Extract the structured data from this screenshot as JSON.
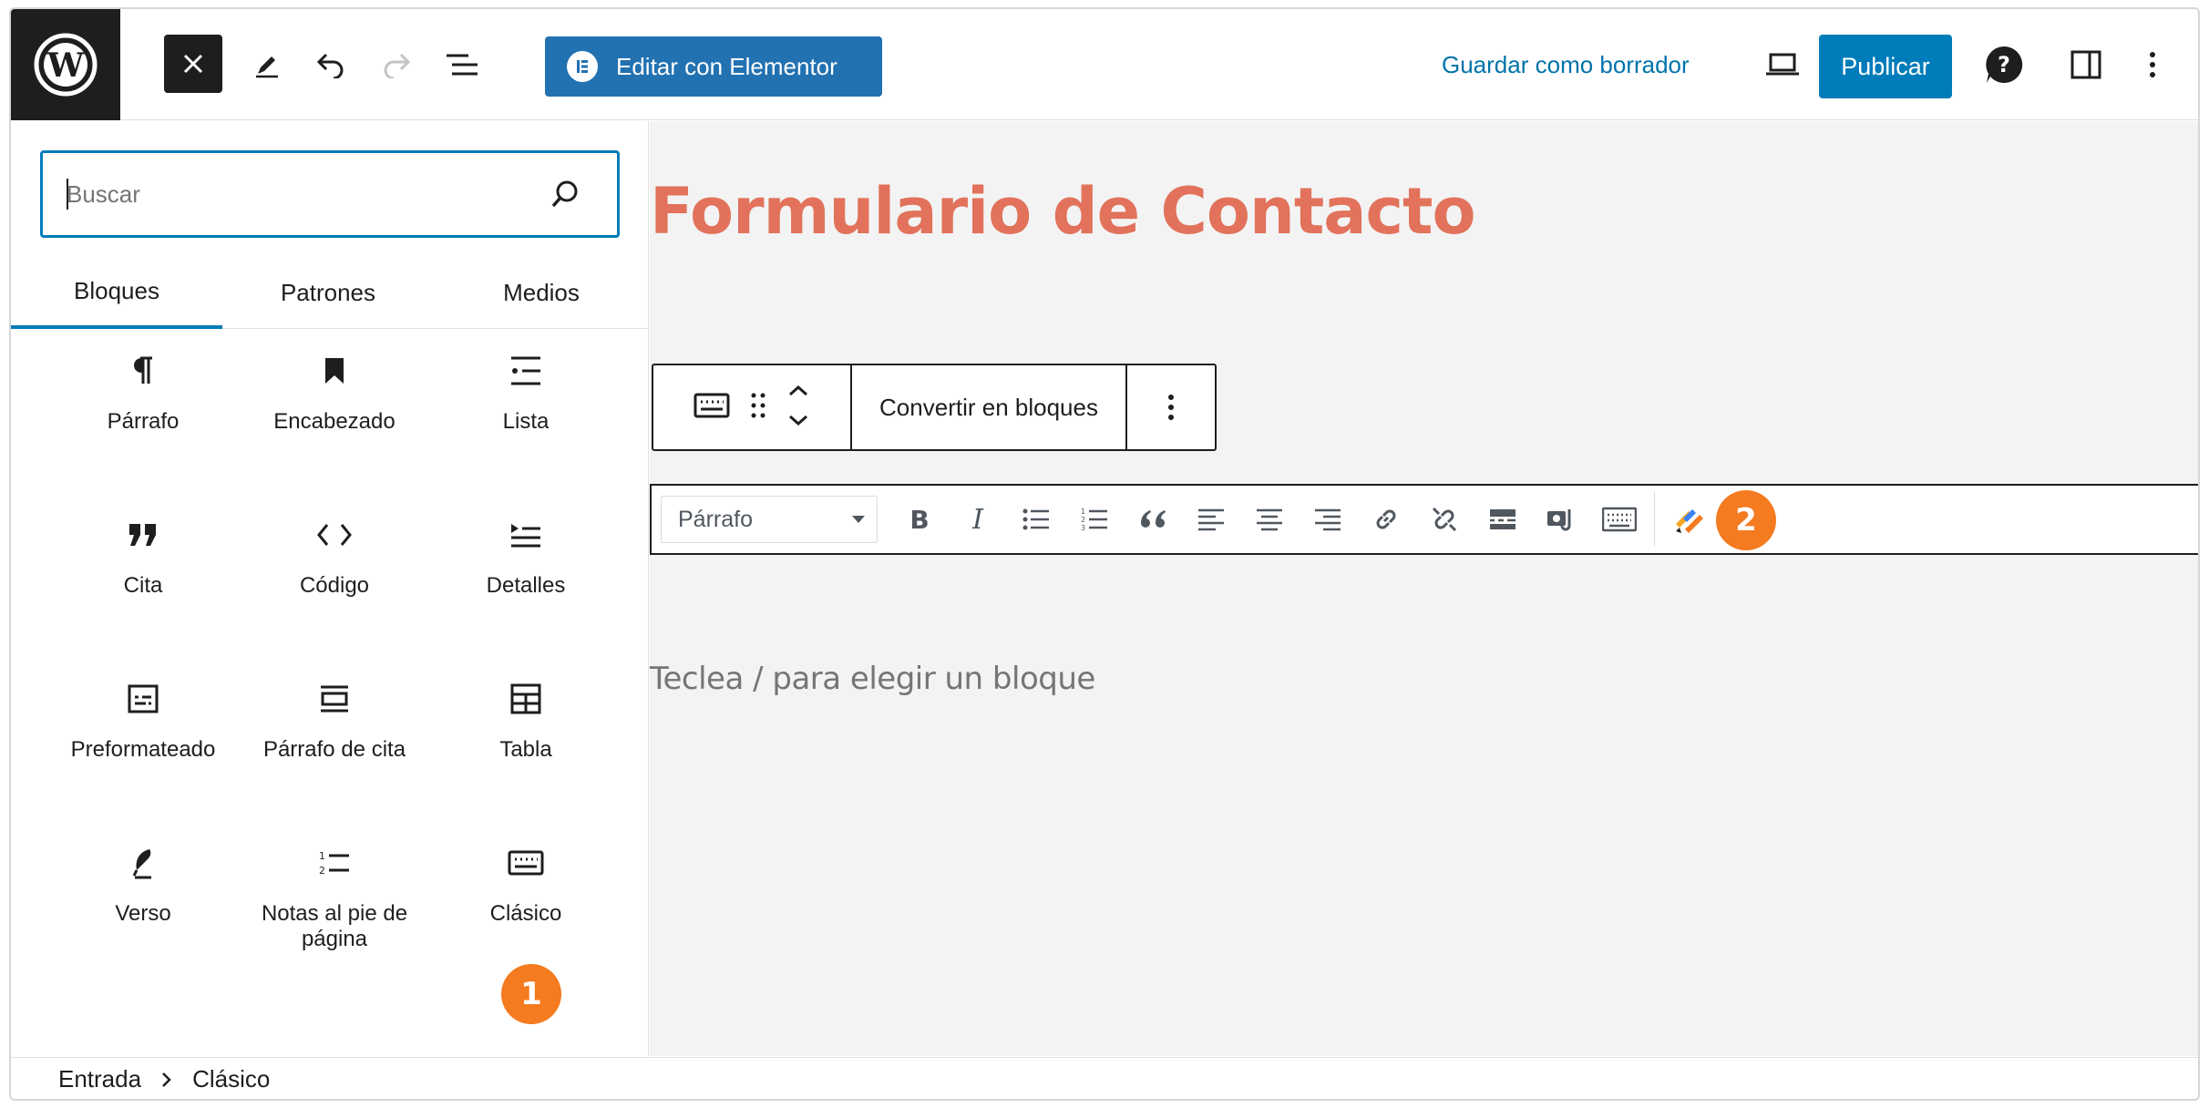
{
  "header": {
    "close_icon": "close-icon",
    "tools_icon": "pencil-icon",
    "undo_icon": "undo-icon",
    "redo_icon": "redo-icon",
    "list_icon": "list-view-icon",
    "elementor_label": "Editar con Elementor",
    "draft_label": "Guardar como borrador",
    "preview_icon": "laptop-icon",
    "publish_label": "Publicar",
    "help_icon": "help-icon",
    "settings_icon": "sidebar-icon",
    "more_icon": "more-vertical-icon",
    "accent_color": "#007cba"
  },
  "inserter": {
    "search": {
      "placeholder": "Buscar",
      "value": ""
    },
    "tabs": [
      {
        "label": "Bloques",
        "active": true
      },
      {
        "label": "Patrones",
        "active": false
      },
      {
        "label": "Medios",
        "active": false
      }
    ],
    "blocks": [
      {
        "label": "Párrafo",
        "icon": "paragraph-icon"
      },
      {
        "label": "Encabezado",
        "icon": "bookmark-icon"
      },
      {
        "label": "Lista",
        "icon": "list-icon"
      },
      {
        "label": "Cita",
        "icon": "quote-icon"
      },
      {
        "label": "Código",
        "icon": "code-icon"
      },
      {
        "label": "Detalles",
        "icon": "details-icon"
      },
      {
        "label": "Preformateado",
        "icon": "preformatted-icon"
      },
      {
        "label": "Párrafo de cita",
        "icon": "pullquote-icon"
      },
      {
        "label": "Tabla",
        "icon": "table-icon"
      },
      {
        "label": "Verso",
        "icon": "feather-icon"
      },
      {
        "label": "Notas al pie de página",
        "icon": "footnotes-icon"
      },
      {
        "label": "Clásico",
        "icon": "keyboard-icon"
      }
    ],
    "marker_1": "1"
  },
  "canvas": {
    "title": "Formulario de Contacto",
    "title_color": "#e2725b",
    "block_toolbar": {
      "convert_label": "Convertir en bloques"
    },
    "classic_toolbar": {
      "format_value": "Párrafo",
      "marker_2": "2"
    },
    "placeholder": "Teclea / para elegir un bloque"
  },
  "footer": {
    "crumbs": [
      "Entrada",
      "Clásico"
    ]
  }
}
